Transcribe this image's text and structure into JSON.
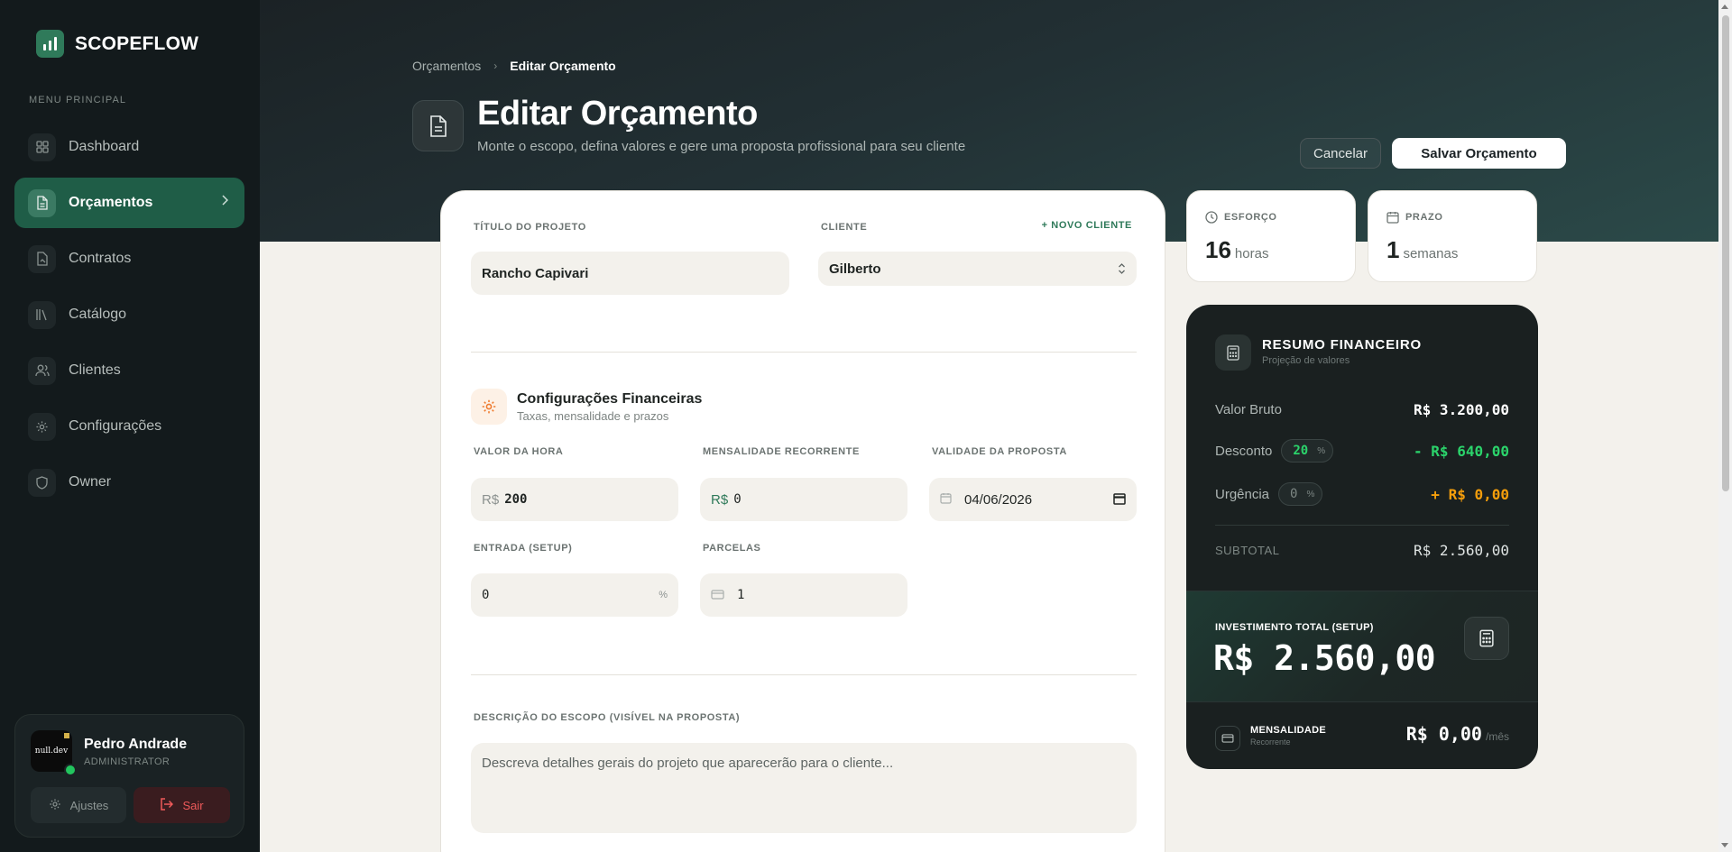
{
  "brand": {
    "name": "SCOPEFLOW"
  },
  "sidebar": {
    "caption": "MENU PRINCIPAL",
    "items": [
      {
        "label": "Dashboard",
        "icon": "grid-icon"
      },
      {
        "label": "Orçamentos",
        "icon": "document-icon",
        "active": true
      },
      {
        "label": "Contratos",
        "icon": "contract-icon"
      },
      {
        "label": "Catálogo",
        "icon": "library-icon"
      },
      {
        "label": "Clientes",
        "icon": "users-icon"
      },
      {
        "label": "Configurações",
        "icon": "gear-icon"
      },
      {
        "label": "Owner",
        "icon": "shield-icon"
      }
    ],
    "user": {
      "name": "Pedro Andrade",
      "role": "ADMINISTRATOR",
      "avatar_text": "null.dev",
      "settings_label": "Ajustes",
      "logout_label": "Sair"
    }
  },
  "header": {
    "breadcrumb": [
      "Orçamentos",
      "Editar Orçamento"
    ],
    "title": "Editar Orçamento",
    "subtitle": "Monte o escopo, defina valores e gere uma proposta profissional para seu cliente",
    "cancel_label": "Cancelar",
    "save_label": "Salvar Orçamento"
  },
  "form": {
    "project_title_label": "TÍTULO DO PROJETO",
    "project_title_value": "Rancho Capivari",
    "client_label": "CLIENTE",
    "new_client_label": "+ NOVO CLIENTE",
    "client_value": "Gilberto",
    "finance_section_title": "Configurações Financeiras",
    "finance_section_sub": "Taxas, mensalidade e prazos",
    "hour_rate_label": "VALOR DA HORA",
    "hour_rate_prefix": "R$",
    "hour_rate_value": "200",
    "monthly_label": "MENSALIDADE RECORRENTE",
    "monthly_prefix": "R$",
    "monthly_value": "0",
    "validity_label": "VALIDADE DA PROPOSTA",
    "validity_value": "04/06/2026",
    "setup_label": "ENTRADA (SETUP)",
    "setup_value": "0",
    "setup_suffix": "%",
    "installments_label": "PARCELAS",
    "installments_value": "1",
    "description_label": "DESCRIÇÃO DO ESCOPO (VISÍVEL NA PROPOSTA)",
    "description_placeholder": "Descreva detalhes gerais do projeto que aparecerão para o cliente..."
  },
  "stats": {
    "effort": {
      "label": "ESFORÇO",
      "value": "16",
      "unit": "horas"
    },
    "deadline": {
      "label": "PRAZO",
      "value": "1",
      "unit": "semanas"
    }
  },
  "summary": {
    "title": "RESUMO FINANCEIRO",
    "subtitle": "Projeção de valores",
    "gross_label": "Valor Bruto",
    "gross_value": "R$ 3.200,00",
    "discount_label": "Desconto",
    "discount_pct": "20",
    "discount_value": "- R$ 640,00",
    "urgency_label": "Urgência",
    "urgency_pct": "0",
    "urgency_value": "+ R$ 0,00",
    "pct_symbol": "%",
    "subtotal_label": "SUBTOTAL",
    "subtotal_value": "R$ 2.560,00",
    "total_label": "INVESTIMENTO TOTAL (SETUP)",
    "total_value": "R$ 2.560,00",
    "monthly_label": "MENSALIDADE",
    "monthly_sub": "Recorrente",
    "monthly_value": "R$ 0,00",
    "monthly_period": "/mês"
  },
  "colors": {
    "accent": "#1f5d47",
    "positive": "#22c55e",
    "discount": "#2bd46b",
    "urgency": "#f59e0b",
    "danger": "#ef5a5a"
  }
}
